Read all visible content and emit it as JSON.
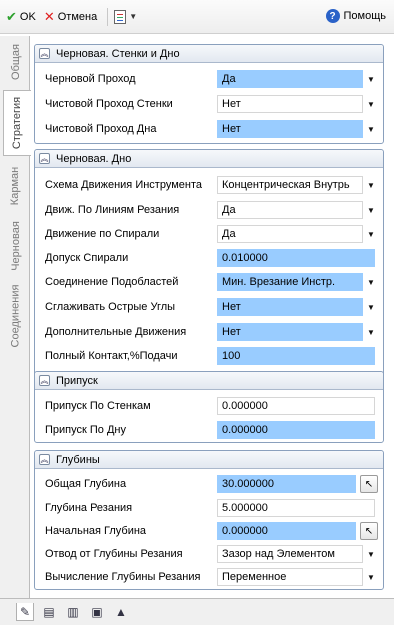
{
  "toolbar": {
    "ok_label": "OK",
    "cancel_label": "Отмена",
    "help_label": "Помощь"
  },
  "vtabs": [
    "Общая",
    "Стратегия",
    "Карман",
    "Черновая",
    "Соединения"
  ],
  "sections": {
    "s1": {
      "title": "Черновая. Стенки и Дно",
      "rows": [
        {
          "label": "Черновой Проход",
          "value": "Да"
        },
        {
          "label": "Чистовой Проход Стенки",
          "value": "Нет"
        },
        {
          "label": "Чистовой Проход Дна",
          "value": "Нет"
        }
      ]
    },
    "s2": {
      "title": "Черновая. Дно",
      "rows": [
        {
          "label": "Схема Движения Инструмента",
          "value": "Концентрическая Внутрь"
        },
        {
          "label": "Движ. По Линиям Резания",
          "value": "Да"
        },
        {
          "label": "Движение по Спирали",
          "value": "Да"
        },
        {
          "label": "Допуск Спирали",
          "value": "0.010000"
        },
        {
          "label": "Соединение Подобластей",
          "value": "Мин. Врезание Инстр."
        },
        {
          "label": "Сглаживать Острые Углы",
          "value": "Нет"
        },
        {
          "label": "Дополнительные Движения",
          "value": "Нет"
        },
        {
          "label": "Полный Контакт,%Подачи",
          "value": "100"
        }
      ]
    },
    "s3": {
      "title": "Припуск",
      "rows": [
        {
          "label": "Припуск По Стенкам",
          "value": "0.000000"
        },
        {
          "label": "Припуск По Дну",
          "value": "0.000000"
        }
      ]
    },
    "s4": {
      "title": "Глубины",
      "rows": [
        {
          "label": "Общая Глубина",
          "value": "30.000000"
        },
        {
          "label": "Глубина Резания",
          "value": "5.000000"
        },
        {
          "label": "Начальная Глубина",
          "value": "0.000000"
        },
        {
          "label": "Отвод от Глубины Резания",
          "value": "Зазор над Элементом"
        },
        {
          "label": "Вычисление Глубины Резания",
          "value": "Переменное"
        }
      ]
    }
  },
  "colors": {
    "highlight": "#99ccff",
    "section_border": "#8aa0bd"
  }
}
